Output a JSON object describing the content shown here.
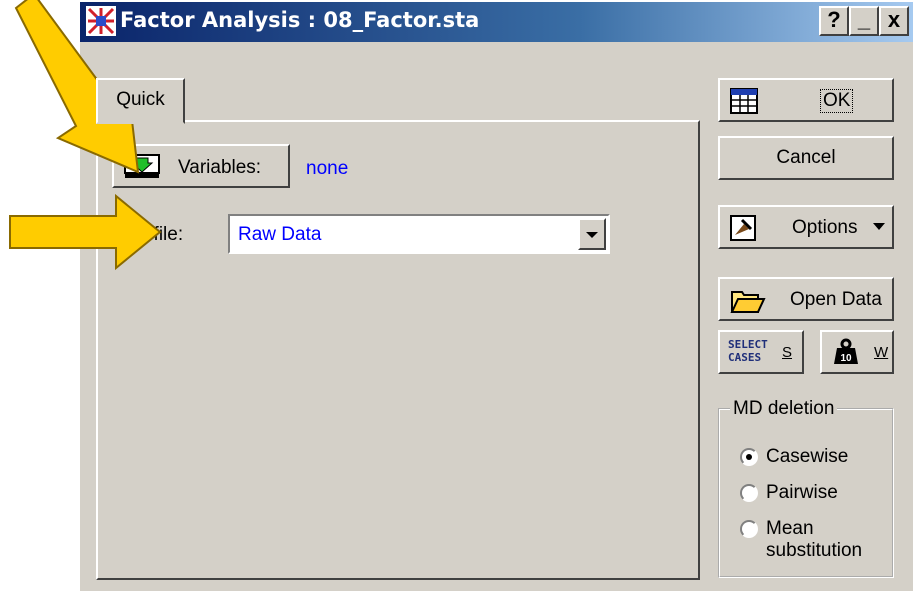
{
  "window": {
    "title": "Factor Analysis : 08_Factor.sta",
    "help_label": "?",
    "minimize_label": "_",
    "close_label": "x"
  },
  "tab": {
    "label": "Quick"
  },
  "variables": {
    "button_label": "Variables:",
    "value": "none"
  },
  "input_file": {
    "label": "Input file:",
    "value": "Raw Data"
  },
  "side_buttons": {
    "ok": "OK",
    "cancel": "Cancel",
    "options": "Options",
    "open_data": "Open Data",
    "select_cases_line1": "SELECT",
    "select_cases_line2": "CASES",
    "select_cases_shortcut": "S",
    "weight_shortcut": "W"
  },
  "md_deletion": {
    "title": "MD deletion",
    "options": [
      "Casewise",
      "Pairwise",
      "Mean",
      "substitution"
    ],
    "selected": "Casewise"
  },
  "colors": {
    "arrow": "#ffcc00",
    "value_text": "#0000ff",
    "title_bar": "#0a246a"
  },
  "icons": [
    "statistica-app-icon",
    "variables-icon",
    "table-icon",
    "options-icon",
    "open-folder-icon",
    "weight-icon",
    "pointer-arrow"
  ]
}
